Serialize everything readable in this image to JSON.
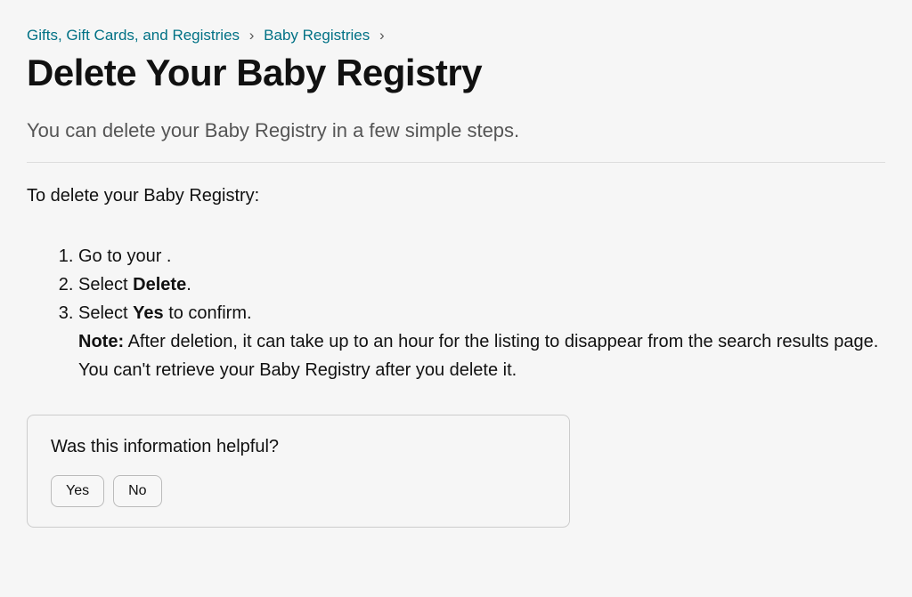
{
  "breadcrumb": {
    "items": [
      {
        "label": "Gifts, Gift Cards, and Registries"
      },
      {
        "label": "Baby Registries"
      }
    ],
    "separator": "›"
  },
  "title": "Delete Your Baby Registry",
  "subtitle": "You can delete your Baby Registry in a few simple steps.",
  "intro": "To delete your Baby Registry:",
  "steps": {
    "s1_prefix": "Go to your .",
    "s2_prefix": "Select ",
    "s2_bold": "Delete",
    "s2_suffix": ".",
    "s3_prefix": "Select ",
    "s3_bold": "Yes",
    "s3_suffix": " to confirm.",
    "note_label": "Note:",
    "note_text": " After deletion, it can take up to an hour for the listing to disappear from the search results page. You can't retrieve your Baby Registry after you delete it."
  },
  "feedback": {
    "question": "Was this information helpful?",
    "yes": "Yes",
    "no": "No"
  }
}
